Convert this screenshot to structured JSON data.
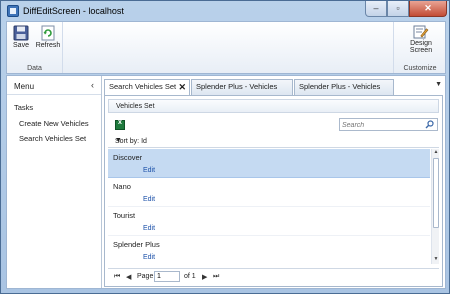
{
  "window": {
    "title": "DiffEditScreen - localhost"
  },
  "ribbon": {
    "data_group": {
      "label": "Data",
      "save_label": "Save",
      "refresh_label": "Refresh"
    },
    "customize_group": {
      "label": "Customize",
      "design_line1": "Design",
      "design_line2": "Screen"
    }
  },
  "menu": {
    "title": "Menu",
    "section": "Tasks",
    "items": [
      "Create New Vehicles",
      "Search Vehicles Set"
    ]
  },
  "tabs": [
    {
      "label": "Search Vehicles Set",
      "active": true
    },
    {
      "label": "Splender Plus - Vehicles",
      "active": false
    },
    {
      "label": "Splender Plus - Vehicles",
      "active": false
    }
  ],
  "panel": {
    "title": "Vehicles Set",
    "search_placeholder": "Search",
    "sort_label": "Sort by: Id",
    "rows": [
      {
        "name": "Discover",
        "action": "Edit",
        "selected": true
      },
      {
        "name": "Nano",
        "action": "Edit",
        "selected": false
      },
      {
        "name": "Tourist",
        "action": "Edit",
        "selected": false
      },
      {
        "name": "Splender Plus",
        "action": "Edit",
        "selected": false
      }
    ],
    "pager": {
      "page_label": "Page",
      "page_value": "1",
      "of_label": "of 1"
    }
  },
  "colors": {
    "accent": "#1a4fa8",
    "selection": "#c5daf2",
    "frame": "#a9c4e3"
  },
  "icons": [
    "save-icon",
    "refresh-icon",
    "design-screen-icon",
    "excel-export-icon",
    "search-icon"
  ]
}
